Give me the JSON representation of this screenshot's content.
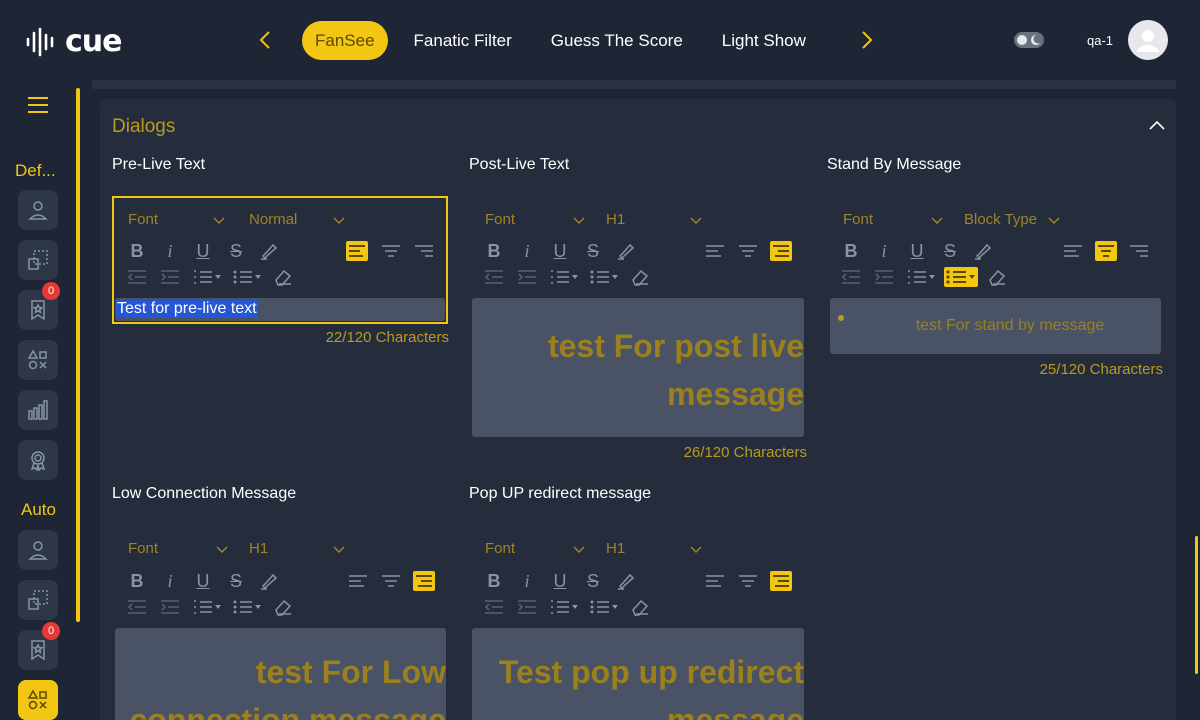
{
  "brand": {
    "logo_text": "cue"
  },
  "nav": {
    "tabs": [
      {
        "label": "FanSee",
        "active": true
      },
      {
        "label": "Fanatic Filter"
      },
      {
        "label": "Guess The Score"
      },
      {
        "label": "Light Show"
      }
    ]
  },
  "user": {
    "name": "qa-1"
  },
  "sidebar": {
    "section_default": "Def...",
    "section_auto": "Auto",
    "badge_count_1": "0",
    "badge_count_2": "0"
  },
  "section": {
    "title": "Dialogs"
  },
  "fields": {
    "pre_live": {
      "title": "Pre-Live Text",
      "font": "Font",
      "block": "Normal",
      "content": "Test for pre-live text",
      "counter": "22/120 Characters"
    },
    "post_live": {
      "title": "Post-Live Text",
      "font": "Font",
      "block": "H1",
      "content": "test For post live message",
      "counter": "26/120 Characters"
    },
    "stand_by": {
      "title": "Stand By Message",
      "font": "Font",
      "block": "Block Type",
      "content": "test For stand by message",
      "counter": "25/120 Characters"
    },
    "low_conn": {
      "title": "Low Connection Message",
      "font": "Font",
      "block": "H1",
      "content": "test For Low connection message"
    },
    "pop_up": {
      "title": "Pop UP redirect message",
      "font": "Font",
      "block": "H1",
      "content": "Test pop up redirect message"
    }
  },
  "colors": {
    "accent": "#f4c614",
    "background": "#1e2535",
    "panel": "#252d3d",
    "editor_content": "#4a5366",
    "muted_gold": "#b99a23"
  }
}
